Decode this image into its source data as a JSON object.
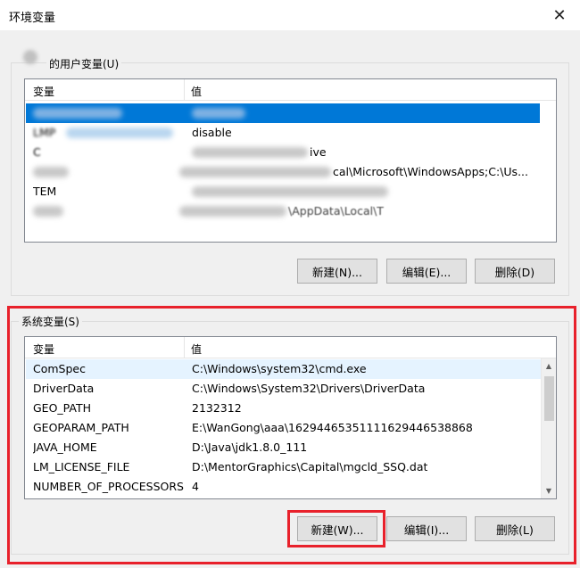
{
  "window": {
    "title": "环境变量"
  },
  "user_group": {
    "label": "的用户变量(U)",
    "columns": [
      "变量",
      "值"
    ],
    "rows": [
      {
        "name": "",
        "value": "",
        "selected": true
      },
      {
        "name": "LMP",
        "value": "disable"
      },
      {
        "name": "C",
        "value": "ive"
      },
      {
        "name": "",
        "value": "cal\\Microsoft\\WindowsApps;C:\\Us..."
      },
      {
        "name": "TEM",
        "value": ""
      },
      {
        "name": "",
        "value": "\\AppData\\Local\\T"
      }
    ],
    "buttons": {
      "new": "新建(N)...",
      "edit": "编辑(E)...",
      "delete": "删除(D)"
    }
  },
  "system_group": {
    "label": "系统变量(S)",
    "columns": [
      "变量",
      "值"
    ],
    "rows": [
      {
        "name": "ComSpec",
        "value": "C:\\Windows\\system32\\cmd.exe",
        "hover": true
      },
      {
        "name": "DriverData",
        "value": "C:\\Windows\\System32\\Drivers\\DriverData"
      },
      {
        "name": "GEO_PATH",
        "value": "2132312"
      },
      {
        "name": "GEOPARAM_PATH",
        "value": "E:\\WanGong\\aaa\\16294465351111629446538868"
      },
      {
        "name": "JAVA_HOME",
        "value": "D:\\Java\\jdk1.8.0_111"
      },
      {
        "name": "LM_LICENSE_FILE",
        "value": "D:\\MentorGraphics\\Capital\\mgcld_SSQ.dat"
      },
      {
        "name": "NUMBER_OF_PROCESSORS",
        "value": "4"
      }
    ],
    "buttons": {
      "new": "新建(W)...",
      "edit": "编辑(I)...",
      "delete": "删除(L)"
    }
  },
  "colors": {
    "selection": "#0078d7",
    "highlight": "#e8212b",
    "window_bg": "#f0f0f0"
  }
}
